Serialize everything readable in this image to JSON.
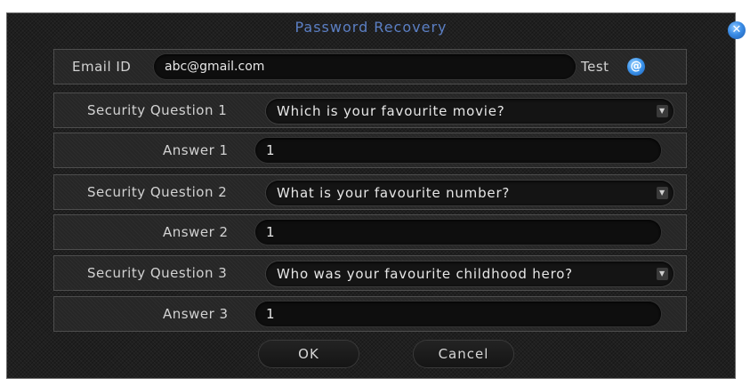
{
  "dialog": {
    "title": "Password Recovery",
    "close_icon": "close-icon"
  },
  "email": {
    "label": "Email ID",
    "value": "abc@gmail.com",
    "test_label": "Test",
    "test_icon": "at-icon"
  },
  "questions": [
    {
      "label": "Security Question 1",
      "value": "Which is your favourite movie?",
      "answer_label": "Answer 1",
      "answer_value": "1"
    },
    {
      "label": "Security Question 2",
      "value": "What is your favourite number?",
      "answer_label": "Answer 2",
      "answer_value": "1"
    },
    {
      "label": "Security Question 3",
      "value": "Who was your favourite childhood hero?",
      "answer_label": "Answer 3",
      "answer_value": "1"
    }
  ],
  "buttons": {
    "ok": "OK",
    "cancel": "Cancel"
  },
  "colors": {
    "title": "#5b7fc4",
    "accent": "#3a8ce6",
    "background": "#1f1f1f"
  }
}
